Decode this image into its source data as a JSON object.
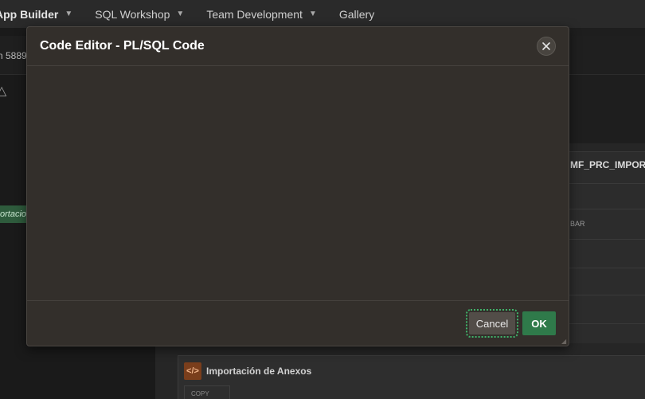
{
  "topnav": {
    "items": [
      {
        "label": "App Builder"
      },
      {
        "label": "SQL Workshop"
      },
      {
        "label": "Team Development"
      },
      {
        "label": "Gallery"
      }
    ]
  },
  "background": {
    "app_id_text": "n 5889",
    "tag_text": "ortacion",
    "procedure_name": "MF_PRC_IMPORT",
    "bar_label": "BAR",
    "region_title": "Importación de Anexos",
    "copy_label": "COPY",
    "region_icon": "</>"
  },
  "dialog": {
    "title": "Code Editor - PL/SQL Code",
    "close_icon": "close-icon",
    "cancel_label": "Cancel",
    "ok_label": "OK"
  },
  "colors": {
    "dialog_bg": "#332f2b",
    "ok_green": "#2f7a4a",
    "cancel_bg": "#524d48",
    "focus_outline": "#3fb36a"
  }
}
